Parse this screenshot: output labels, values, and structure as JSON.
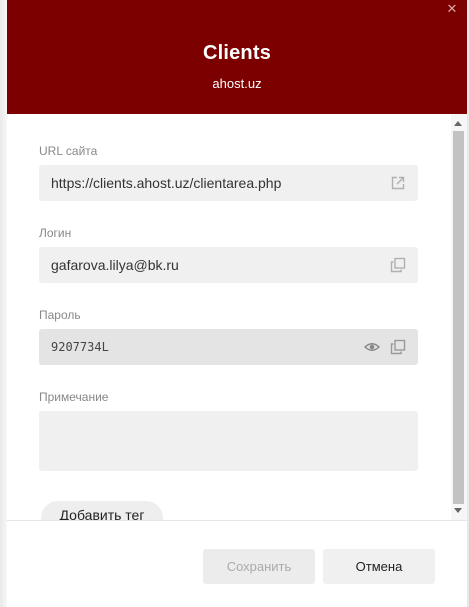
{
  "header": {
    "title": "Clients",
    "subtitle": "ahost.uz"
  },
  "fields": {
    "url": {
      "label": "URL сайта",
      "value": "https://clients.ahost.uz/clientarea.php"
    },
    "login": {
      "label": "Логин",
      "value": "gafarova.lilya@bk.ru"
    },
    "password": {
      "label": "Пароль",
      "value": "9207734L"
    },
    "note": {
      "label": "Примечание",
      "value": ""
    }
  },
  "tag_button": {
    "label": "Добавить тег"
  },
  "footer": {
    "save_label": "Сохранить",
    "cancel_label": "Отмена"
  },
  "colors": {
    "header_bg": "#7c0000",
    "field_bg": "#f0f0f0"
  },
  "icons": {
    "close": "close-icon",
    "open_link": "external-link-icon",
    "copy": "copy-icon",
    "show_password": "eye-icon"
  }
}
